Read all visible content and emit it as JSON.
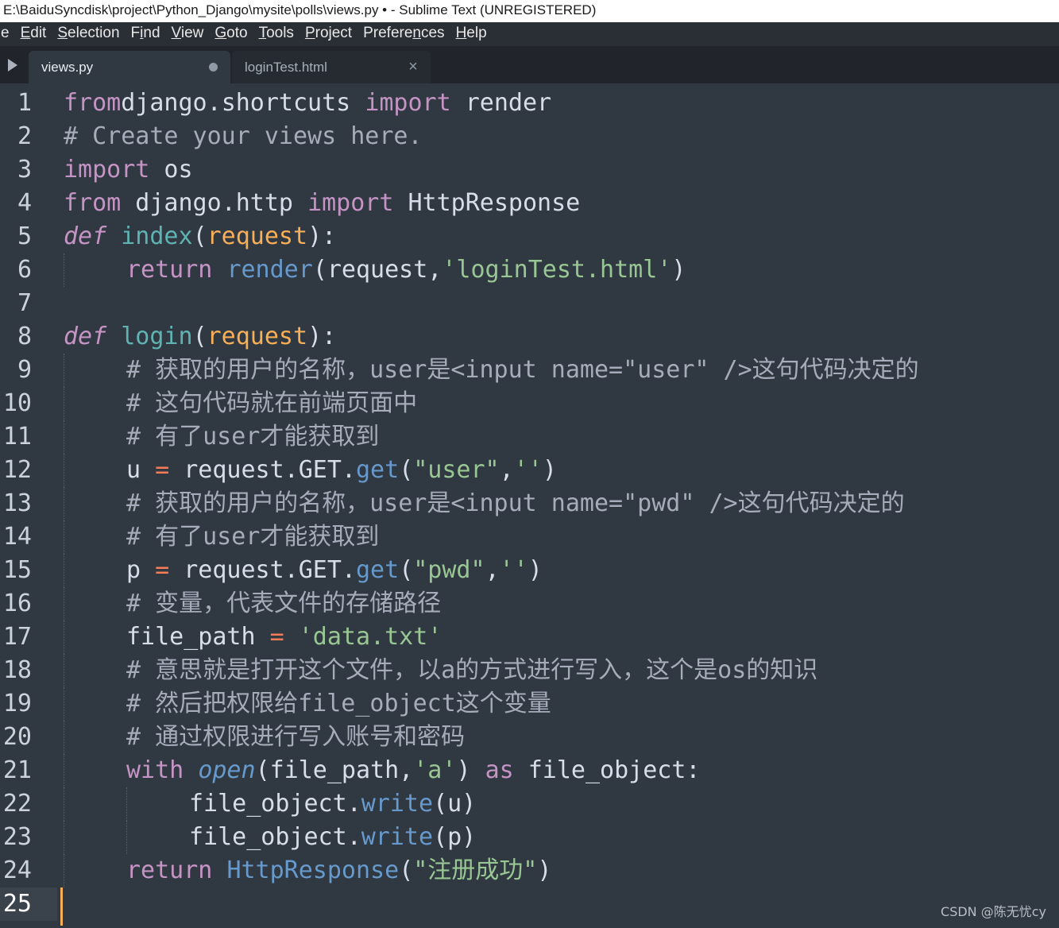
{
  "window": {
    "title": "E:\\BaiduSyncdisk\\project\\Python_Django\\mysite\\polls\\views.py • - Sublime Text (UNREGISTERED)"
  },
  "menu": [
    {
      "label": "e"
    },
    {
      "label": "Edit",
      "mnemonic": "E"
    },
    {
      "label": "Selection",
      "mnemonic": "S"
    },
    {
      "label": "Find",
      "mnemonic": "i"
    },
    {
      "label": "View",
      "mnemonic": "V"
    },
    {
      "label": "Goto",
      "mnemonic": "G"
    },
    {
      "label": "Tools",
      "mnemonic": "T"
    },
    {
      "label": "Project",
      "mnemonic": "P"
    },
    {
      "label": "Preferences",
      "mnemonic": "n"
    },
    {
      "label": "Help",
      "mnemonic": "H"
    }
  ],
  "tabs": [
    {
      "label": "views.py",
      "active": true,
      "modified": true
    },
    {
      "label": "loginTest.html",
      "active": false,
      "close_glyph": "×"
    }
  ],
  "editor": {
    "line_numbers": [
      "1",
      "2",
      "3",
      "4",
      "5",
      "6",
      "7",
      "8",
      "9",
      "10",
      "11",
      "12",
      "13",
      "14",
      "15",
      "16",
      "17",
      "18",
      "19",
      "20",
      "21",
      "22",
      "23",
      "24",
      "25"
    ],
    "current_line": 25,
    "lines": [
      [
        [
          "kw",
          "from"
        ],
        [
          "",
          "django"
        ],
        [
          "dot",
          "."
        ],
        [
          "",
          "shortcuts "
        ],
        [
          "kw",
          "import"
        ],
        [
          "",
          " render"
        ]
      ],
      [
        [
          "cmt",
          "# Create your views here."
        ]
      ],
      [
        [
          "kw",
          "import"
        ],
        [
          "",
          " os"
        ]
      ],
      [
        [
          "kw",
          "from"
        ],
        [
          "",
          " django"
        ],
        [
          "dot",
          "."
        ],
        [
          "",
          "http "
        ],
        [
          "kw",
          "import"
        ],
        [
          "",
          " HttpResponse"
        ]
      ],
      [
        [
          "kw it",
          "def"
        ],
        [
          "",
          " "
        ],
        [
          "def-name",
          "index"
        ],
        [
          "",
          "("
        ],
        [
          "param",
          "request"
        ],
        [
          "",
          "):"
        ]
      ],
      [
        [
          "kw",
          "return"
        ],
        [
          "",
          " "
        ],
        [
          "fn",
          "render"
        ],
        [
          "",
          "(request,"
        ],
        [
          "str",
          "'loginTest.html'"
        ],
        [
          "",
          ")"
        ]
      ],
      [],
      [
        [
          "kw it",
          "def"
        ],
        [
          "",
          " "
        ],
        [
          "def-name",
          "login"
        ],
        [
          "",
          "("
        ],
        [
          "param",
          "request"
        ],
        [
          "",
          "):"
        ]
      ],
      [
        [
          "cmt",
          "# 获取的用户的名称，user是<input name=\"user\" />这句代码决定的"
        ]
      ],
      [
        [
          "cmt",
          "# 这句代码就在前端页面中"
        ]
      ],
      [
        [
          "cmt",
          "# 有了user才能获取到"
        ]
      ],
      [
        [
          "",
          "u "
        ],
        [
          "op",
          "="
        ],
        [
          "",
          " request"
        ],
        [
          "dot",
          "."
        ],
        [
          "",
          "GET"
        ],
        [
          "dot",
          "."
        ],
        [
          "fn",
          "get"
        ],
        [
          "",
          "("
        ],
        [
          "str",
          "\"user\""
        ],
        [
          "",
          ","
        ],
        [
          "str",
          "''"
        ],
        [
          "",
          ")"
        ]
      ],
      [
        [
          "cmt",
          "# 获取的用户的名称，user是<input name=\"pwd\" />这句代码决定的"
        ]
      ],
      [
        [
          "cmt",
          "# 有了user才能获取到"
        ]
      ],
      [
        [
          "",
          "p "
        ],
        [
          "op",
          "="
        ],
        [
          "",
          " request"
        ],
        [
          "dot",
          "."
        ],
        [
          "",
          "GET"
        ],
        [
          "dot",
          "."
        ],
        [
          "fn",
          "get"
        ],
        [
          "",
          "("
        ],
        [
          "str",
          "\"pwd\""
        ],
        [
          "",
          ","
        ],
        [
          "str",
          "''"
        ],
        [
          "",
          ")"
        ]
      ],
      [
        [
          "cmt",
          "# 变量，代表文件的存储路径"
        ]
      ],
      [
        [
          "",
          "file_path "
        ],
        [
          "op",
          "="
        ],
        [
          "",
          " "
        ],
        [
          "str",
          "'data.txt'"
        ]
      ],
      [
        [
          "cmt",
          "# 意思就是打开这个文件，以a的方式进行写入，这个是os的知识"
        ]
      ],
      [
        [
          "cmt",
          "# 然后把权限给file_object这个变量"
        ]
      ],
      [
        [
          "cmt",
          "# 通过权限进行写入账号和密码"
        ]
      ],
      [
        [
          "kw",
          "with"
        ],
        [
          "",
          " "
        ],
        [
          "fn it",
          "open"
        ],
        [
          "",
          "(file_path,"
        ],
        [
          "str",
          "'a'"
        ],
        [
          "",
          ") "
        ],
        [
          "kw",
          "as"
        ],
        [
          "",
          " file_object:"
        ]
      ],
      [
        [
          "",
          "file_object"
        ],
        [
          "dot",
          "."
        ],
        [
          "fn",
          "write"
        ],
        [
          "",
          "(u)"
        ]
      ],
      [
        [
          "",
          "file_object"
        ],
        [
          "dot",
          "."
        ],
        [
          "fn",
          "write"
        ],
        [
          "",
          "(p)"
        ]
      ],
      [
        [
          "kw",
          "return"
        ],
        [
          "",
          " "
        ],
        [
          "fn",
          "HttpResponse"
        ],
        [
          "",
          "("
        ],
        [
          "str",
          "\"注册成功\""
        ],
        [
          "",
          ")"
        ]
      ],
      []
    ],
    "indent": [
      0,
      0,
      0,
      0,
      0,
      1,
      0,
      0,
      1,
      1,
      1,
      1,
      1,
      1,
      1,
      1,
      1,
      1,
      1,
      1,
      1,
      2,
      2,
      1,
      0
    ]
  },
  "watermark": "CSDN @陈无忧cy"
}
